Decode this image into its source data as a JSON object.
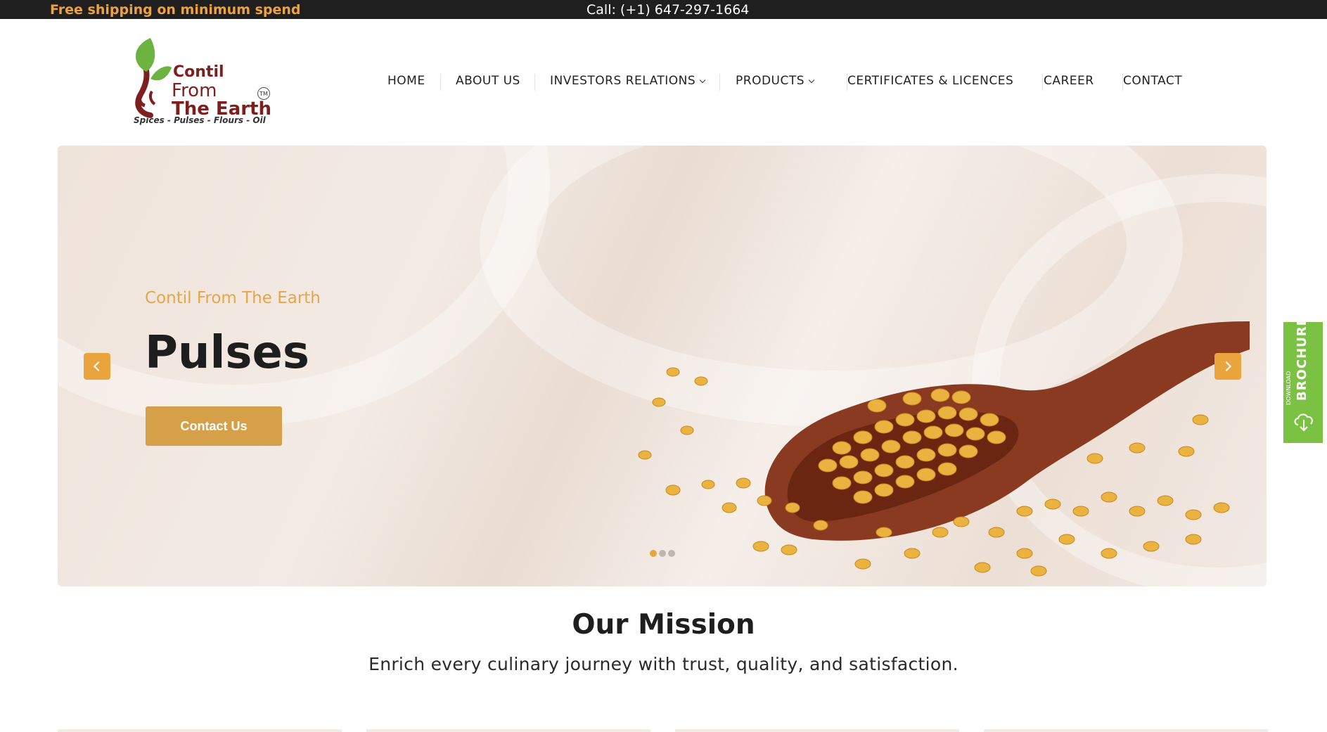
{
  "topbar": {
    "promo": "Free shipping on minimum spend",
    "call": "Call: (+1) 647-297-1664"
  },
  "logo": {
    "line1": "Contil",
    "line2": "From",
    "line3": "The Earth",
    "tm": "TM",
    "tagline": "Spices - Pulses - Flours - Oil"
  },
  "nav": {
    "items": [
      {
        "label": "HOME"
      },
      {
        "label": "ABOUT US"
      },
      {
        "label": "INVESTORS RELATIONS"
      },
      {
        "label": "PRODUCTS"
      },
      {
        "label": "CERTIFICATES & LICENCES"
      },
      {
        "label": "CAREER"
      },
      {
        "label": "CONTACT"
      }
    ]
  },
  "hero": {
    "kicker": "Contil From The Earth",
    "title": "Pulses",
    "cta": "Contact Us",
    "slide_count": 3,
    "active_slide": 1
  },
  "brochure": {
    "small": "DOWNLOAD",
    "big": "BROCHURE"
  },
  "mission": {
    "title": "Our Mission",
    "text": "Enrich every culinary journey with trust, quality, and satisfaction."
  },
  "colors": {
    "accent": "#e9a43e",
    "button": "#d5a047",
    "topbar": "#1f1f1f",
    "brochure": "#7cc242",
    "brand_red": "#7e1f1f"
  }
}
